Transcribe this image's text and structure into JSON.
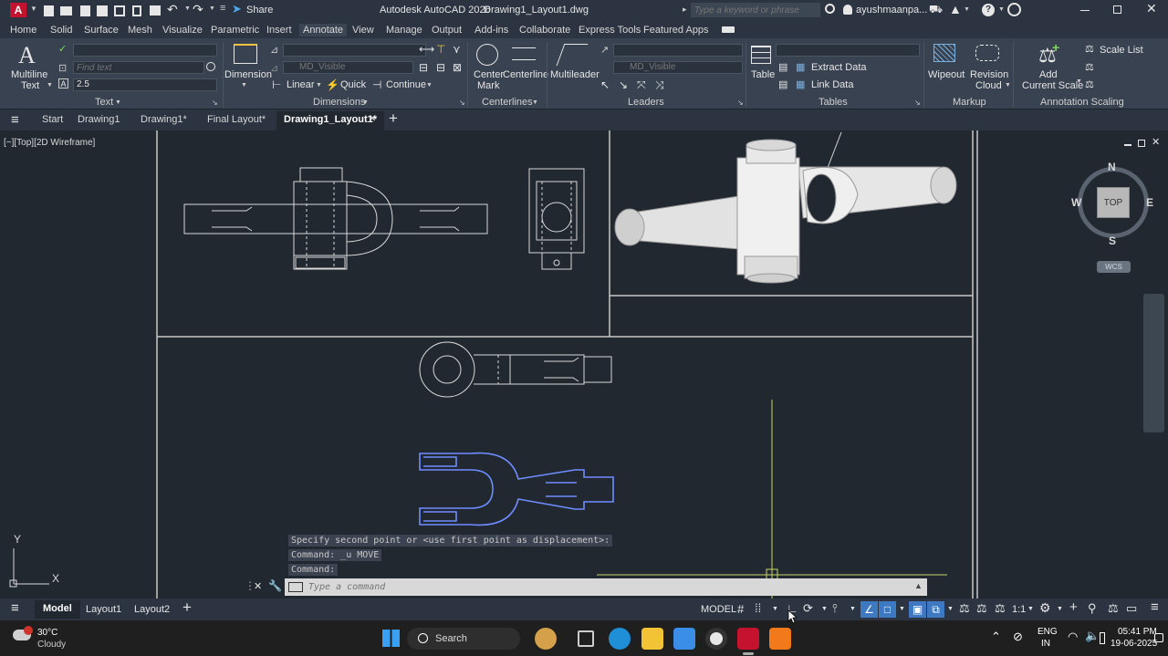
{
  "titlebar": {
    "app_badge": "A",
    "share_label": "Share",
    "title": "Autodesk AutoCAD 2026",
    "filename": "Drawing1_Layout1.dwg",
    "search_placeholder": "Type a keyword or phrase",
    "user": "ayushmaanpa..."
  },
  "ribbon_tabs": [
    "Home",
    "Solid",
    "Surface",
    "Mesh",
    "Visualize",
    "Parametric",
    "Insert",
    "Annotate",
    "View",
    "Manage",
    "Output",
    "Add-ins",
    "Collaborate",
    "Express Tools",
    "Featured Apps"
  ],
  "ribbon": {
    "text_panel": {
      "multiline_1": "Multiline",
      "multiline_2": "Text",
      "find_placeholder": "Find text",
      "height": "2.5",
      "label": "Text"
    },
    "dimensions_panel": {
      "dimension": "Dimension",
      "layer": "MD_Visible",
      "linear": "Linear",
      "quick": "Quick",
      "continue": "Continue",
      "label": "Dimensions"
    },
    "centerlines_panel": {
      "center_mark_1": "Center",
      "center_mark_2": "Mark",
      "centerline": "Centerline",
      "label": "Centerlines"
    },
    "leaders_panel": {
      "multileader": "Multileader",
      "layer": "MD_Visible",
      "label": "Leaders"
    },
    "tables_panel": {
      "table": "Table",
      "extract": "Extract Data",
      "link": "Link Data",
      "label": "Tables"
    },
    "markup_panel": {
      "wipeout": "Wipeout",
      "revision_1": "Revision",
      "revision_2": "Cloud",
      "label": "Markup"
    },
    "scaling_panel": {
      "add_1": "Add",
      "add_2": "Current Scale",
      "scale_list": "Scale List",
      "label": "Annotation Scaling"
    }
  },
  "doc_tabs": [
    "Start",
    "Drawing1",
    "Drawing1*",
    "Final Layout*",
    "Drawing1_Layout1*"
  ],
  "viewport_label": "[−][Top][2D Wireframe]",
  "viewcube": {
    "n": "N",
    "s": "S",
    "e": "E",
    "w": "W",
    "top": "TOP",
    "wcs": "WCS"
  },
  "ucs": {
    "x": "X",
    "y": "Y"
  },
  "command": {
    "history": [
      "Specify second point or <use first point as displacement>:",
      "Command: _u MOVE",
      "Command:"
    ],
    "placeholder": "Type a command"
  },
  "layout_tabs": [
    "Model",
    "Layout1",
    "Layout2"
  ],
  "status": {
    "model": "MODEL",
    "scale": "1:1"
  },
  "taskbar": {
    "temp": "30°C",
    "weather": "Cloudy",
    "search": "Search",
    "lang_1": "ENG",
    "lang_2": "IN",
    "time": "05:41 PM",
    "date": "19-06-2025"
  }
}
